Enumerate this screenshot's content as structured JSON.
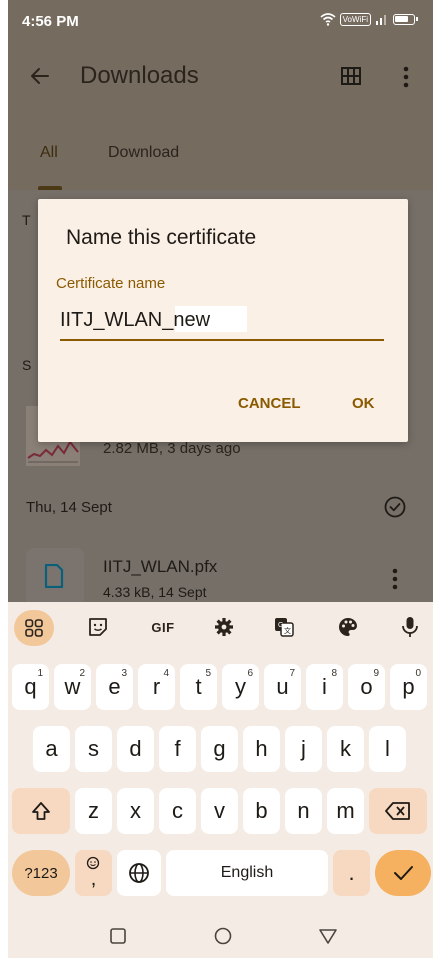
{
  "status_bar": {
    "time": "4:56 PM",
    "vowifi": "VoWiFi"
  },
  "app_bar": {
    "title": "Downloads"
  },
  "tabs": [
    {
      "label": "All"
    },
    {
      "label": "Download"
    }
  ],
  "content": {
    "section_partial_1": "T",
    "section_partial_2": "S",
    "file1": {
      "meta": "2.82 MB, 3 days ago"
    },
    "date_header": "Thu, 14 Sept",
    "file2": {
      "name": "IITJ_WLAN.pfx",
      "meta": "4.33 kB, 14 Sept"
    }
  },
  "dialog": {
    "title": "Name this certificate",
    "field_label": "Certificate name",
    "field_value": "IITJ_WLAN_new",
    "cancel_label": "CANCEL",
    "ok_label": "OK"
  },
  "keyboard": {
    "toolbar": {
      "gif": "GIF"
    },
    "row1": [
      {
        "key": "q",
        "hint": "1"
      },
      {
        "key": "w",
        "hint": "2"
      },
      {
        "key": "e",
        "hint": "3"
      },
      {
        "key": "r",
        "hint": "4"
      },
      {
        "key": "t",
        "hint": "5"
      },
      {
        "key": "y",
        "hint": "6"
      },
      {
        "key": "u",
        "hint": "7"
      },
      {
        "key": "i",
        "hint": "8"
      },
      {
        "key": "o",
        "hint": "9"
      },
      {
        "key": "p",
        "hint": "0"
      }
    ],
    "row2": [
      "a",
      "s",
      "d",
      "f",
      "g",
      "h",
      "j",
      "k",
      "l"
    ],
    "row3": [
      "z",
      "x",
      "c",
      "v",
      "b",
      "n",
      "m"
    ],
    "symbols_label": "?123",
    "emoji_comma": ",",
    "space_label": "English",
    "period_label": "."
  },
  "colors": {
    "accent": "#8a5a00",
    "dialog_bg": "#fbf0e6",
    "keyboard_bg": "#f4ece4",
    "enter_key": "#f5b060"
  }
}
